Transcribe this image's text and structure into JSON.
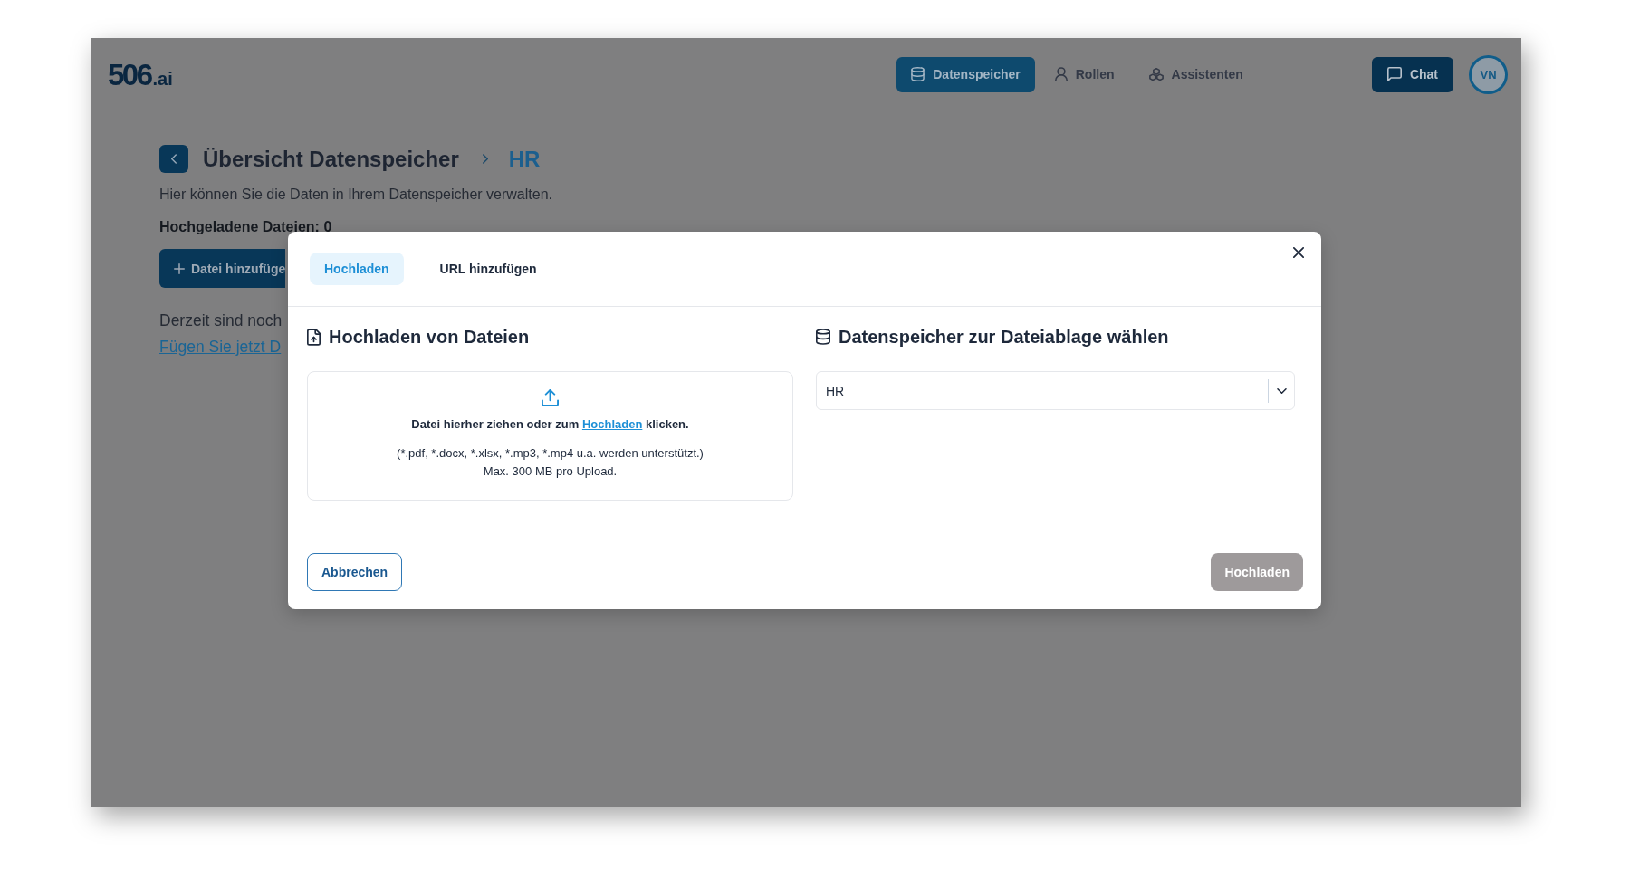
{
  "header": {
    "logo": {
      "mark": "506",
      "suffix": ".ai"
    },
    "nav": [
      {
        "label": "Datenspeicher",
        "selected": true
      },
      {
        "label": "Rollen",
        "selected": false
      },
      {
        "label": "Assistenten",
        "selected": false
      }
    ],
    "chat_button": "Chat",
    "avatar": "VN"
  },
  "page": {
    "breadcrumb": [
      {
        "label": "Übersicht Datenspeicher",
        "current": false
      },
      {
        "label": "HR",
        "current": true
      }
    ],
    "description": "Hier können Sie die Daten in Ihrem Datenspeicher verwalten.",
    "uploaded_count": "Hochgeladene Dateien: 0",
    "add_button": "Datei hinzufüge",
    "empty_text": "Derzeit sind noch",
    "empty_link": "Fügen Sie jetzt D"
  },
  "modal": {
    "tabs": [
      {
        "label": "Hochladen",
        "selected": true
      },
      {
        "label": "URL hinzufügen",
        "selected": false
      }
    ],
    "upload_section": {
      "title": "Hochladen von Dateien",
      "instructions": {
        "before": "Datei hierher ziehen oder zum",
        "link": "Hochladen",
        "after": "klicken."
      },
      "formats_hint": "(*.pdf, *.docx, *.xlsx, *.mp3, *.mp4 u.a. werden unterstützt.)",
      "size_limit": "Max. 300 MB pro Upload."
    },
    "target_section": {
      "title": "Datenspeicher zur Dateiablage wählen",
      "select": {
        "value": "HR"
      }
    },
    "buttons": [
      {
        "label": "Abbrechen",
        "kind": "secondary",
        "disabled": false
      },
      {
        "label": "Hochladen",
        "kind": "primary",
        "disabled": true
      }
    ]
  }
}
